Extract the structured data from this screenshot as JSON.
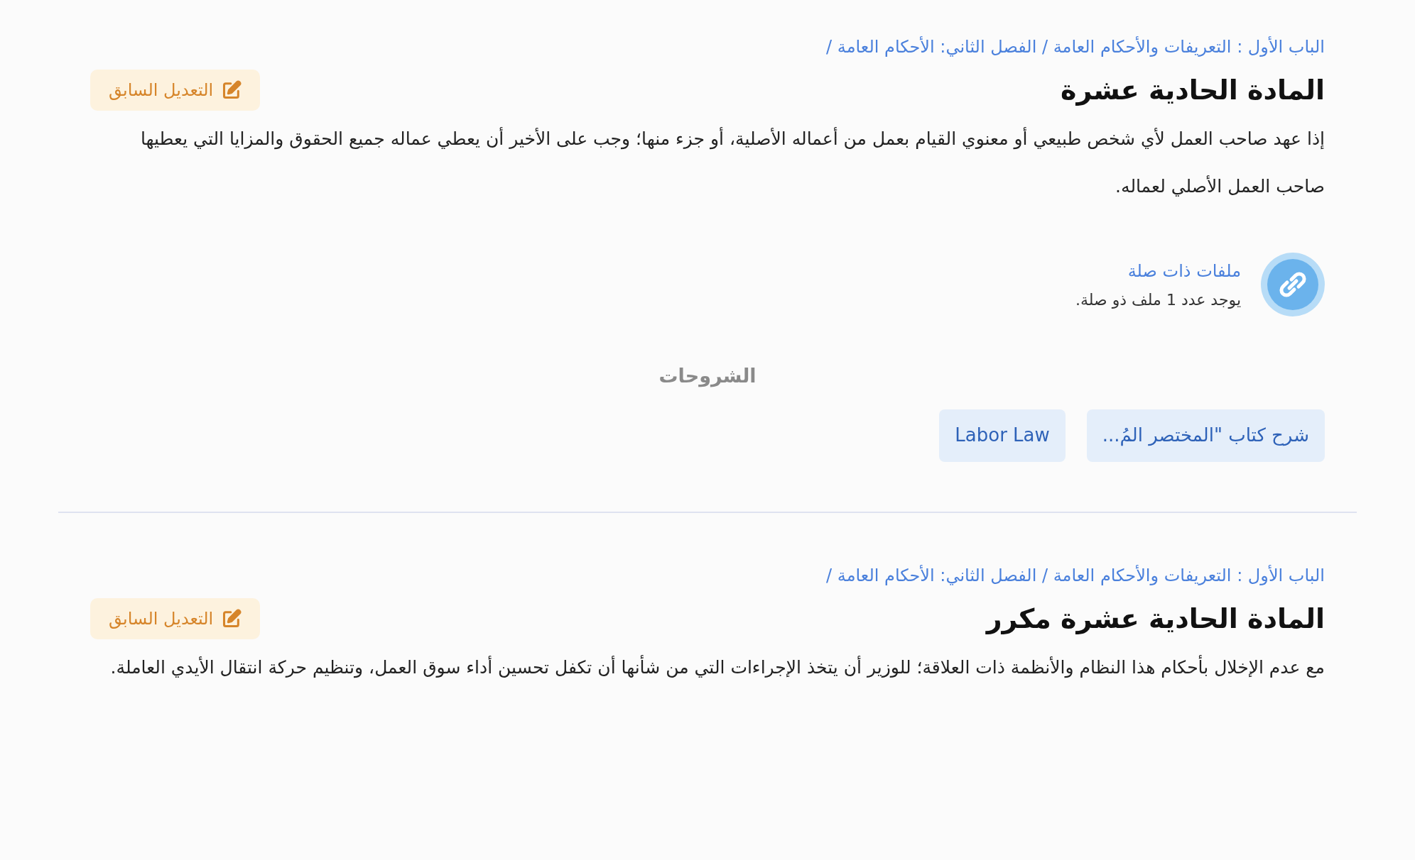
{
  "articles": [
    {
      "breadcrumb": "الباب الأول : التعريفات والأحكام العامة / الفصل الثاني: الأحكام العامة /",
      "title": "المادة الحادية عشرة",
      "edit_button": "التعديل السابق",
      "body": "إذا عهد صاحب العمل لأي شخص طبيعي أو معنوي القيام بعمل من أعماله الأصلية، أو جزء منها؛ وجب على الأخير أن يعطي عماله جميع الحقوق والمزايا التي يعطيها صاحب العمل الأصلي لعماله.",
      "related_files": {
        "title": "ملفات ذات صلة",
        "description": "يوجد عدد 1 ملف ذو صلة."
      },
      "commentaries": {
        "heading": "الشروحات",
        "items": [
          "شرح كتاب \"المختصر المُ...",
          "Labor Law"
        ]
      }
    },
    {
      "breadcrumb": "الباب الأول : التعريفات والأحكام العامة / الفصل الثاني: الأحكام العامة /",
      "title": "المادة الحادية عشرة مكرر",
      "edit_button": "التعديل السابق",
      "body": "مع عدم الإخلال بأحكام هذا النظام والأنظمة ذات العلاقة؛ للوزير أن يتخذ الإجراءات التي من شأنها أن تكفل تحسين أداء سوق العمل، وتنظيم حركة انتقال الأيدي العاملة."
    }
  ]
}
